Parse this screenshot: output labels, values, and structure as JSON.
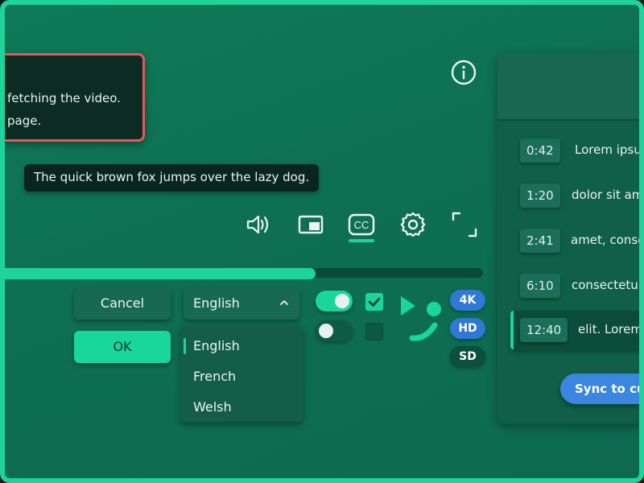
{
  "error": {
    "line1": "fetching the video.",
    "line2": "page."
  },
  "info_icon": "info-circle-icon",
  "subtitle": "The quick brown fox jumps over the lazy dog.",
  "controls": [
    "volume-icon",
    "picture-in-picture-icon",
    "closed-captions-icon",
    "settings-gear-icon",
    "fullscreen-icon"
  ],
  "captions_label": "CC",
  "progress": 0.65,
  "buttons": {
    "cancel": "Cancel",
    "ok": "OK"
  },
  "language": {
    "selected": "English",
    "options": [
      "English",
      "French",
      "Welsh"
    ]
  },
  "toggles": [
    {
      "on": true
    },
    {
      "on": false
    }
  ],
  "checkboxes": [
    {
      "checked": true
    },
    {
      "checked": false
    }
  ],
  "quality_badges": [
    "4K",
    "HD",
    "SD"
  ],
  "transcript": {
    "cues": [
      {
        "time": "0:42",
        "text": "Lorem ipsum"
      },
      {
        "time": "1:20",
        "text": "dolor sit amet"
      },
      {
        "time": "2:41",
        "text": "amet, consectetur"
      },
      {
        "time": "6:10",
        "text": "consectetur"
      },
      {
        "time": "12:40",
        "text": "elit. Lorem"
      }
    ],
    "sync_label": "Sync to current"
  },
  "colors": {
    "accent": "#1fd49a",
    "background": "#0e6f52",
    "error": "#e5585e",
    "badge_blue": "#2f78d4",
    "sync_blue": "#3a86e0"
  }
}
